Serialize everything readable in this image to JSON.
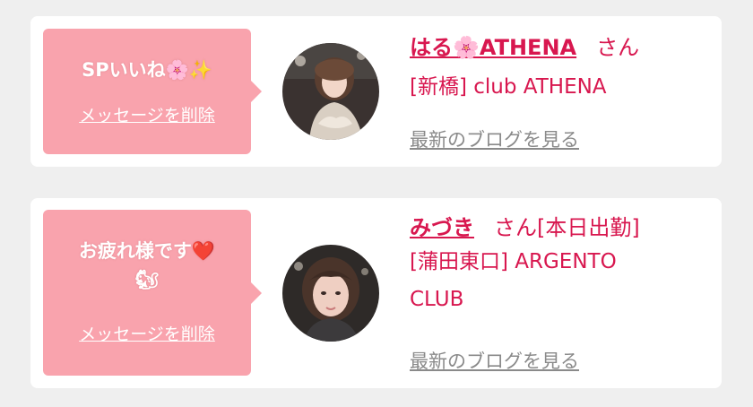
{
  "cards": [
    {
      "message": "SPいいね🌸✨",
      "message_lines": [
        "SPいいね🌸✨"
      ],
      "delete_label": "メッセージを削除",
      "name": "はる🌸ATHENA",
      "honorific": "さん",
      "status": "",
      "shop_lines": [
        "[新橋] club ATHENA"
      ],
      "blog_label": "最新のブログを見る"
    },
    {
      "message": "お疲れ様です❤️🐿",
      "message_lines": [
        "お疲れ様です❤️",
        "🐿"
      ],
      "delete_label": "メッセージを削除",
      "name": "みづき",
      "honorific": "さん",
      "status": "[本日出勤]",
      "shop_lines": [
        "[蒲田東口] ARGENTO",
        "CLUB"
      ],
      "blog_label": "最新のブログを見る"
    }
  ],
  "colors": {
    "bubble": "#f9a3ad",
    "accent": "#d8174f",
    "muted": "#8a8a8a",
    "background": "#efefef"
  }
}
